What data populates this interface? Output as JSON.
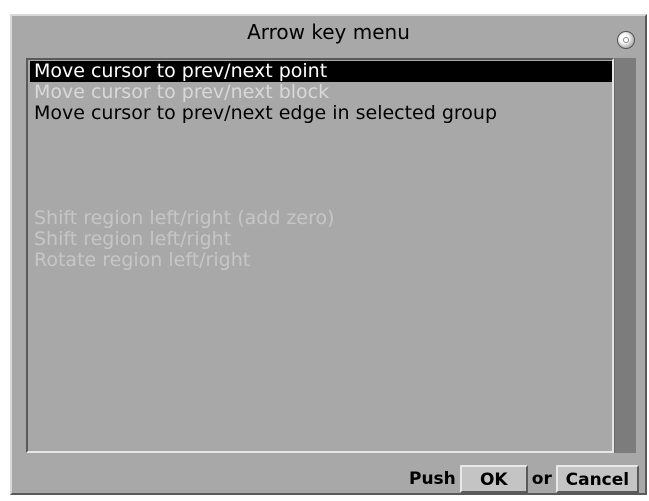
{
  "dialog": {
    "title": "Arrow key menu"
  },
  "items": [
    {
      "label": "Move cursor to prev/next point",
      "state": "selected"
    },
    {
      "label": "Move cursor to prev/next block",
      "state": "disabled"
    },
    {
      "label": "Move cursor to prev/next edge in selected group",
      "state": "normal"
    },
    {
      "label": "",
      "state": "blank"
    },
    {
      "label": "",
      "state": "blank"
    },
    {
      "label": "",
      "state": "blank"
    },
    {
      "label": "",
      "state": "blank"
    },
    {
      "label": "Shift region left/right (add zero)",
      "state": "disabled"
    },
    {
      "label": "Shift region left/right",
      "state": "disabled"
    },
    {
      "label": "Rotate region left/right",
      "state": "disabled"
    }
  ],
  "footer": {
    "push_label": "Push",
    "ok_label": "OK",
    "or_label": "or",
    "cancel_label": "Cancel"
  },
  "colors": {
    "dialog_bg": "#a8a8a8",
    "selected_bg": "#000000",
    "selected_fg": "#ffffff",
    "disabled_fg": "#d8d8d8"
  }
}
